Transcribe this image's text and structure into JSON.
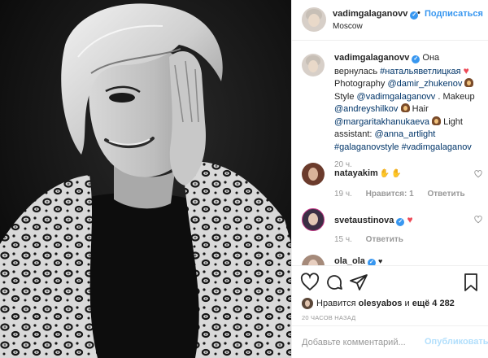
{
  "post": {
    "author": "vadimgalaganovv",
    "location": "Moscow",
    "follow_label": "Подписаться",
    "separator": "•",
    "verified_icon": "verified-badge-icon"
  },
  "caption": {
    "author": "vadimgalaganovv",
    "intro": "Она вернулась",
    "hashtag_name": "#натальяветлицкая",
    "photo_word": "Photography",
    "photographer": "@damir_zhukenov",
    "style_word": "Style",
    "stylist": "@vadimgalaganovv",
    "makeup_word": ". Makeup",
    "makeup_artist": "@andreyshilkov",
    "hair_word": "Hair",
    "hair_artist": "@margaritakhanukaeva",
    "light_word": "Light assistant:",
    "light_assistant": "@anna_artlight",
    "tag1": "#galaganovstyle",
    "tag2": "#vadimgalaganov",
    "time": "20 ч."
  },
  "comments": [
    {
      "user": "natayakim",
      "text": "",
      "emoji": [
        "raised-hands",
        "raised-hands"
      ],
      "time": "",
      "likes": "",
      "reply": ""
    },
    {
      "user": "",
      "text": "",
      "time": "19 ч.",
      "likes": "Нравится: 1",
      "reply": "Ответить"
    },
    {
      "user": "svetaustinova",
      "verified": true,
      "emoji": [
        "heart"
      ],
      "time": "15 ч.",
      "reply": "Ответить"
    },
    {
      "user": "ola_ola",
      "verified": true,
      "emoji": [
        "heart"
      ]
    }
  ],
  "likes_line": {
    "prefix": "Нравится",
    "user": "olesyabos",
    "middle": "и",
    "rest": "ещё 4 282"
  },
  "ago": "20 часов назад",
  "add_comment": {
    "placeholder": "Добавьте комментарий...",
    "publish": "Опубликовать"
  },
  "colors": {
    "accent": "#3897f0",
    "heart": "#ed4956",
    "muted": "#999999",
    "publish_disabled": "#b2dffc"
  }
}
